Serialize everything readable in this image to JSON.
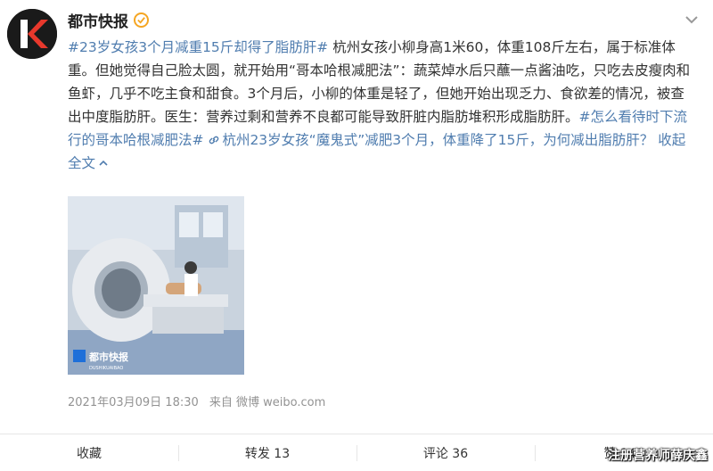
{
  "post": {
    "username": "都市快报",
    "verified_badge": "verified-badge-icon",
    "more_icon": "chevron-down-icon",
    "text": {
      "hashtag1": "#23岁女孩3个月减重15斤却得了脂肪肝#",
      "body": " 杭州女孩小柳身高1米60，体重108斤左右，属于标准体重。但她觉得自己脸太圆，就开始用“哥本哈根减肥法”：蔬菜焯水后只蘸一点酱油吃，只吃去皮瘦肉和鱼虾，几乎不吃主食和甜食。3个月后，小柳的体重是轻了，但她开始出现乏力、食欲差的情况，被查出中度脂肪肝。医生：营养过剩和营养不良都可能导致肝脏内脂肪堆积形成脂肪肝。",
      "hashtag2": "#怎么看待时下流行的哥本哈根减肥法#",
      "link_text": "杭州23岁女孩“魔鬼式”减肥3个月，体重降了15斤，为何减出脂肪肝？",
      "collapse": "收起全文"
    },
    "image": {
      "logo_text": "都市快报",
      "logo_sub": "DUSHIKUAIBAO"
    },
    "meta": {
      "datetime": "2021年03月09日 18:30",
      "source": "来自 微博 weibo.com"
    }
  },
  "actions": [
    {
      "label": "收藏"
    },
    {
      "label": "转发 13"
    },
    {
      "label": "评论 36"
    },
    {
      "label": "赞 146"
    }
  ],
  "watermark": "注册营养师薛庆鑫",
  "colors": {
    "link": "#507daf",
    "text": "#333333",
    "meta": "#939393",
    "avatar_accent": "#e8382c"
  }
}
